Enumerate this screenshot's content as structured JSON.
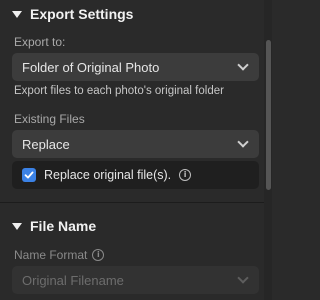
{
  "export_settings": {
    "title": "Export Settings",
    "export_to_label": "Export to:",
    "export_to_value": "Folder of Original Photo",
    "export_to_help": "Export files to each photo's original folder",
    "existing_files_label": "Existing Files",
    "existing_files_value": "Replace",
    "replace_checkbox_label": "Replace original file(s).",
    "replace_checked": true
  },
  "file_name": {
    "title": "File Name",
    "name_format_label": "Name Format",
    "name_format_value": "Original Filename"
  },
  "icons": {
    "info": "info-icon",
    "caret": "caret-down-icon",
    "chevron": "chevron-down-icon",
    "check": "checkmark-icon"
  },
  "colors": {
    "background": "#2a2a2a",
    "dropdown": "#3c3c3c",
    "accent": "#3b82e6"
  }
}
